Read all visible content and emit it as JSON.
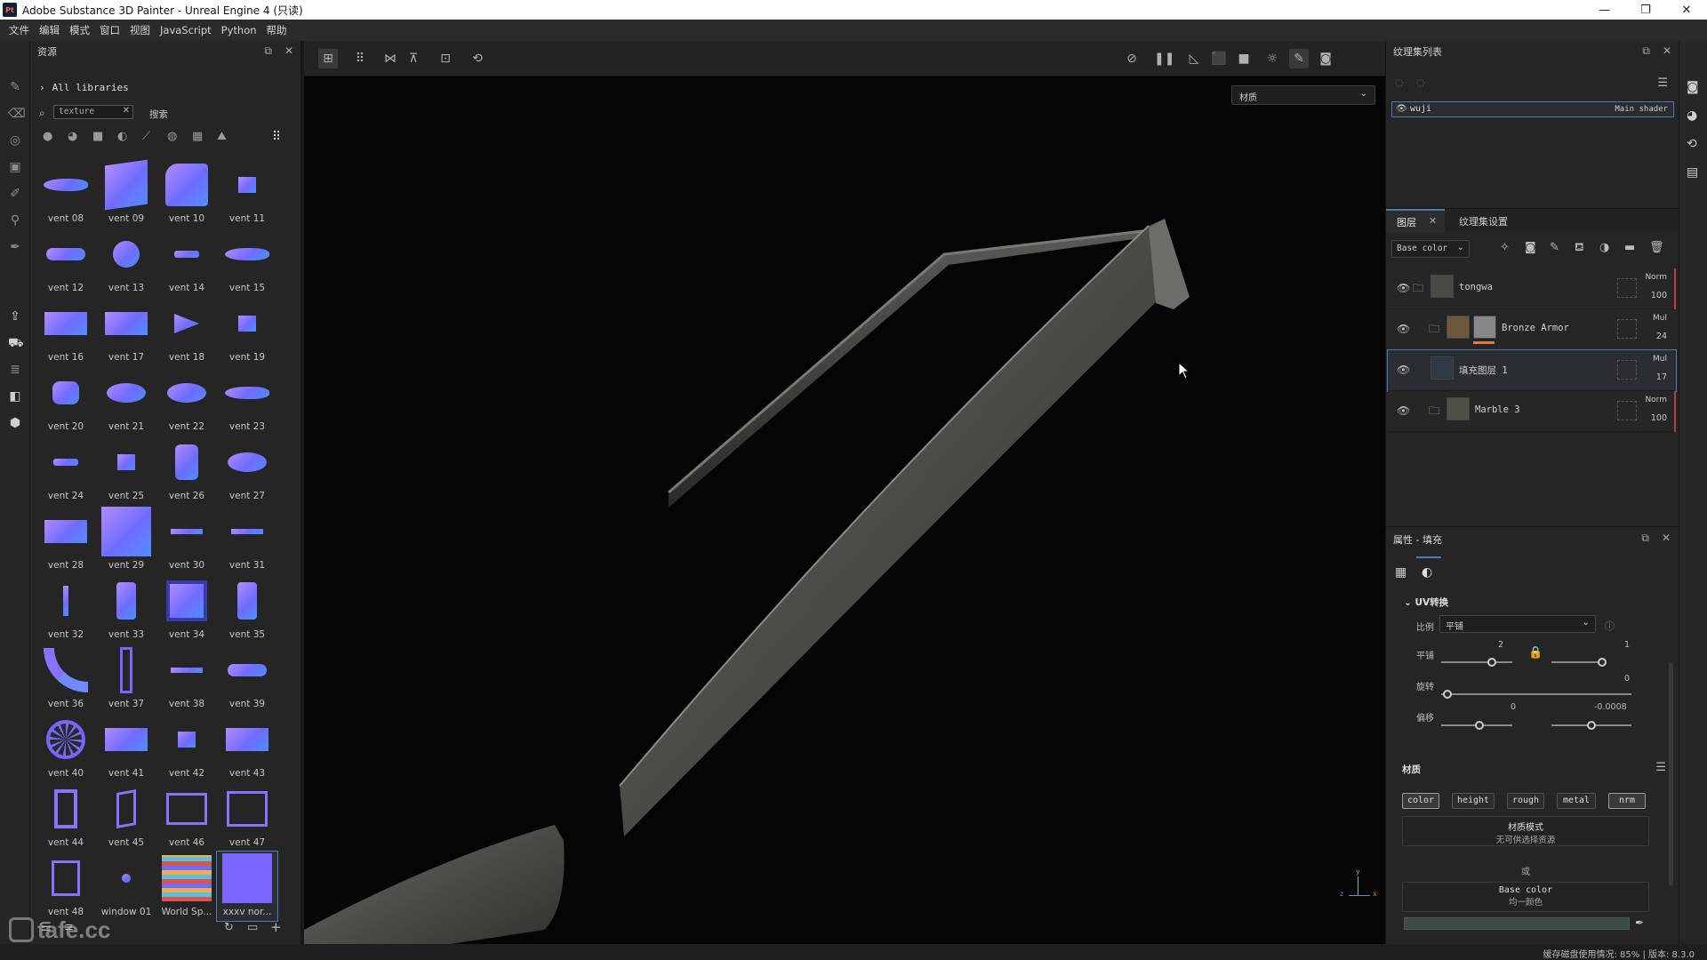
{
  "window": {
    "app_title": "Adobe Substance 3D Painter - Unreal Engine 4 (只读)",
    "app_icon": "Pt",
    "controls": [
      "—",
      "❐",
      "✕"
    ]
  },
  "menu": [
    "文件",
    "编辑",
    "模式",
    "窗口",
    "视图",
    "JavaScript",
    "Python",
    "帮助"
  ],
  "assets_panel": {
    "title": "资源",
    "breadcrumb": "All libraries",
    "search_value": "texture",
    "search_label": "搜索",
    "filter_icons": [
      "sphere-icon",
      "smart-material-icon",
      "texture-icon",
      "material-icon",
      "brush-icon",
      "alpha-icon",
      "grid-icon",
      "environment-icon",
      "grid-view-icon"
    ],
    "items": [
      {
        "label": "vent 08",
        "shape": "drop"
      },
      {
        "label": "vent 09",
        "shape": "tall"
      },
      {
        "label": "vent 10",
        "shape": "curve"
      },
      {
        "label": "vent 11",
        "shape": "small"
      },
      {
        "label": "vent 12",
        "shape": "pill"
      },
      {
        "label": "vent 13",
        "shape": "circle"
      },
      {
        "label": "vent 14",
        "shape": "thin"
      },
      {
        "label": "vent 15",
        "shape": "drop"
      },
      {
        "label": "vent 16",
        "shape": "rect"
      },
      {
        "label": "vent 17",
        "shape": "rect"
      },
      {
        "label": "vent 18",
        "shape": "tri"
      },
      {
        "label": "vent 19",
        "shape": "small"
      },
      {
        "label": "vent 20",
        "shape": "roundsq"
      },
      {
        "label": "vent 21",
        "shape": "oval"
      },
      {
        "label": "vent 22",
        "shape": "oval"
      },
      {
        "label": "vent 23",
        "shape": "drop"
      },
      {
        "label": "vent 24",
        "shape": "thin"
      },
      {
        "label": "vent 25",
        "shape": "small"
      },
      {
        "label": "vent 26",
        "shape": "tall2"
      },
      {
        "label": "vent 27",
        "shape": "oval"
      },
      {
        "label": "vent 28",
        "shape": "rect"
      },
      {
        "label": "vent 29",
        "shape": "big"
      },
      {
        "label": "vent 30",
        "shape": "line"
      },
      {
        "label": "vent 31",
        "shape": "line"
      },
      {
        "label": "vent 32",
        "shape": "vline"
      },
      {
        "label": "vent 33",
        "shape": "tall3"
      },
      {
        "label": "vent 34",
        "shape": "framed"
      },
      {
        "label": "vent 35",
        "shape": "tall3"
      },
      {
        "label": "vent 36",
        "shape": "arc"
      },
      {
        "label": "vent 37",
        "shape": "ladder"
      },
      {
        "label": "vent 38",
        "shape": "line"
      },
      {
        "label": "vent 39",
        "shape": "pill"
      },
      {
        "label": "vent 40",
        "shape": "wheel"
      },
      {
        "label": "vent 41",
        "shape": "rect"
      },
      {
        "label": "vent 42",
        "shape": "small"
      },
      {
        "label": "vent 43",
        "shape": "rect"
      },
      {
        "label": "vent 44",
        "shape": "frame"
      },
      {
        "label": "vent 45",
        "shape": "frame2"
      },
      {
        "label": "vent 46",
        "shape": "frame3"
      },
      {
        "label": "vent 47",
        "shape": "frame4"
      },
      {
        "label": "vent 48",
        "shape": "frame5"
      },
      {
        "label": "window 01",
        "shape": "dot"
      },
      {
        "label": "World Sp...",
        "shape": "stack"
      },
      {
        "label": "xxxv nor...",
        "shape": "flat"
      }
    ]
  },
  "viewport": {
    "material_dropdown": "材质",
    "axis_labels": [
      "y",
      "z",
      "x"
    ]
  },
  "texture_set_list": {
    "title": "纹理集列表",
    "item_name": "wuji",
    "item_shader": "Main shader"
  },
  "layers_panel": {
    "tab_layers": "图层",
    "tab_settings": "纹理集设置",
    "channel": "Base color",
    "layers": [
      {
        "name": "tongwa",
        "blend": "Norm",
        "opacity": "100",
        "thumb": "#4a4a44",
        "accent": "#c23b3b",
        "folder": true
      },
      {
        "name": "Bronze Armor",
        "blend": "Mul",
        "opacity": "24",
        "thumb": "#6e5a3e",
        "accent": "",
        "folder": true
      },
      {
        "name": "填充图层 1",
        "blend": "Mul",
        "opacity": "17",
        "thumb": "#2e3a46",
        "accent": "",
        "folder": false
      },
      {
        "name": "Marble 3",
        "blend": "Norm",
        "opacity": "100",
        "thumb": "#505048",
        "accent": "#c23b3b",
        "folder": true
      }
    ]
  },
  "properties_panel": {
    "title": "属性 - 填充",
    "uv_section": "UV转换",
    "scale_label": "比例",
    "scale_value": "平铺",
    "tile_label": "平铺",
    "tile_val_1": "2",
    "tile_val_2": "1",
    "rotate_label": "旋转",
    "rotate_val": "0",
    "offset_label": "偏移",
    "offset_val_1": "0",
    "offset_val_2": "-0.0008",
    "material_section": "材质",
    "channels": [
      "color",
      "height",
      "rough",
      "metal",
      "nrm"
    ],
    "material_mode": "材质模式",
    "material_mode_desc": "无可供选择资源",
    "or_label": "或",
    "base_color_label": "Base color",
    "base_color_desc": "均一颜色"
  },
  "status_bar": {
    "text": "缓存磁盘使用情况:   85%  |  版本:   8.3.0"
  },
  "watermark": "tafe.cc"
}
